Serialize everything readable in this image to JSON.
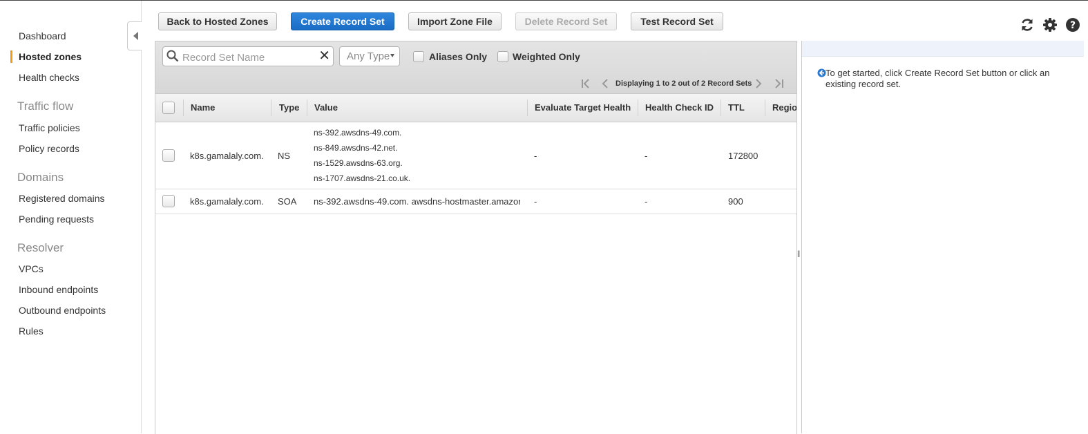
{
  "sidebar": {
    "items": [
      {
        "label": "Dashboard"
      },
      {
        "label": "Hosted zones"
      },
      {
        "label": "Health checks"
      },
      {
        "label": "Traffic policies"
      },
      {
        "label": "Policy records"
      },
      {
        "label": "Registered domains"
      },
      {
        "label": "Pending requests"
      },
      {
        "label": "VPCs"
      },
      {
        "label": "Inbound endpoints"
      },
      {
        "label": "Outbound endpoints"
      },
      {
        "label": "Rules"
      }
    ],
    "sections": {
      "traffic_flow": "Traffic flow",
      "domains": "Domains",
      "resolver": "Resolver"
    },
    "active_item": "Hosted zones",
    "accent_color": "#f39c12"
  },
  "toolbar": {
    "back_label": "Back to Hosted Zones",
    "create_label": "Create Record Set",
    "import_label": "Import Zone File",
    "delete_label": "Delete Record Set",
    "test_label": "Test Record Set",
    "icons": [
      "refresh-icon",
      "gear-icon",
      "help-icon"
    ],
    "primary_color": "#1a6cc5"
  },
  "filters": {
    "search_placeholder": "Record Set Name",
    "search_value": "",
    "type_selected": "Any Type",
    "aliases_only_label": "Aliases Only",
    "weighted_only_label": "Weighted Only"
  },
  "pager": {
    "text": "Displaying 1 to 2 out of 2 Record Sets"
  },
  "table": {
    "columns": {
      "name": "Name",
      "type": "Type",
      "value": "Value",
      "eval": "Evaluate Target Health",
      "hc": "Health Check ID",
      "ttl": "TTL",
      "region": "Regio"
    },
    "rows": [
      {
        "name": "k8s.gamalaly.com.",
        "type": "NS",
        "values": [
          "ns-392.awsdns-49.com.",
          "ns-849.awsdns-42.net.",
          "ns-1529.awsdns-63.org.",
          "ns-1707.awsdns-21.co.uk."
        ],
        "eval": "-",
        "hc": "-",
        "ttl": "172800"
      },
      {
        "name": "k8s.gamalaly.com.",
        "type": "SOA",
        "values": [
          "ns-392.awsdns-49.com. awsdns-hostmaster.amazon"
        ],
        "eval": "-",
        "hc": "-",
        "ttl": "900"
      }
    ]
  },
  "info_panel": {
    "text": "To get started, click Create Record Set button or click an existing record set."
  }
}
